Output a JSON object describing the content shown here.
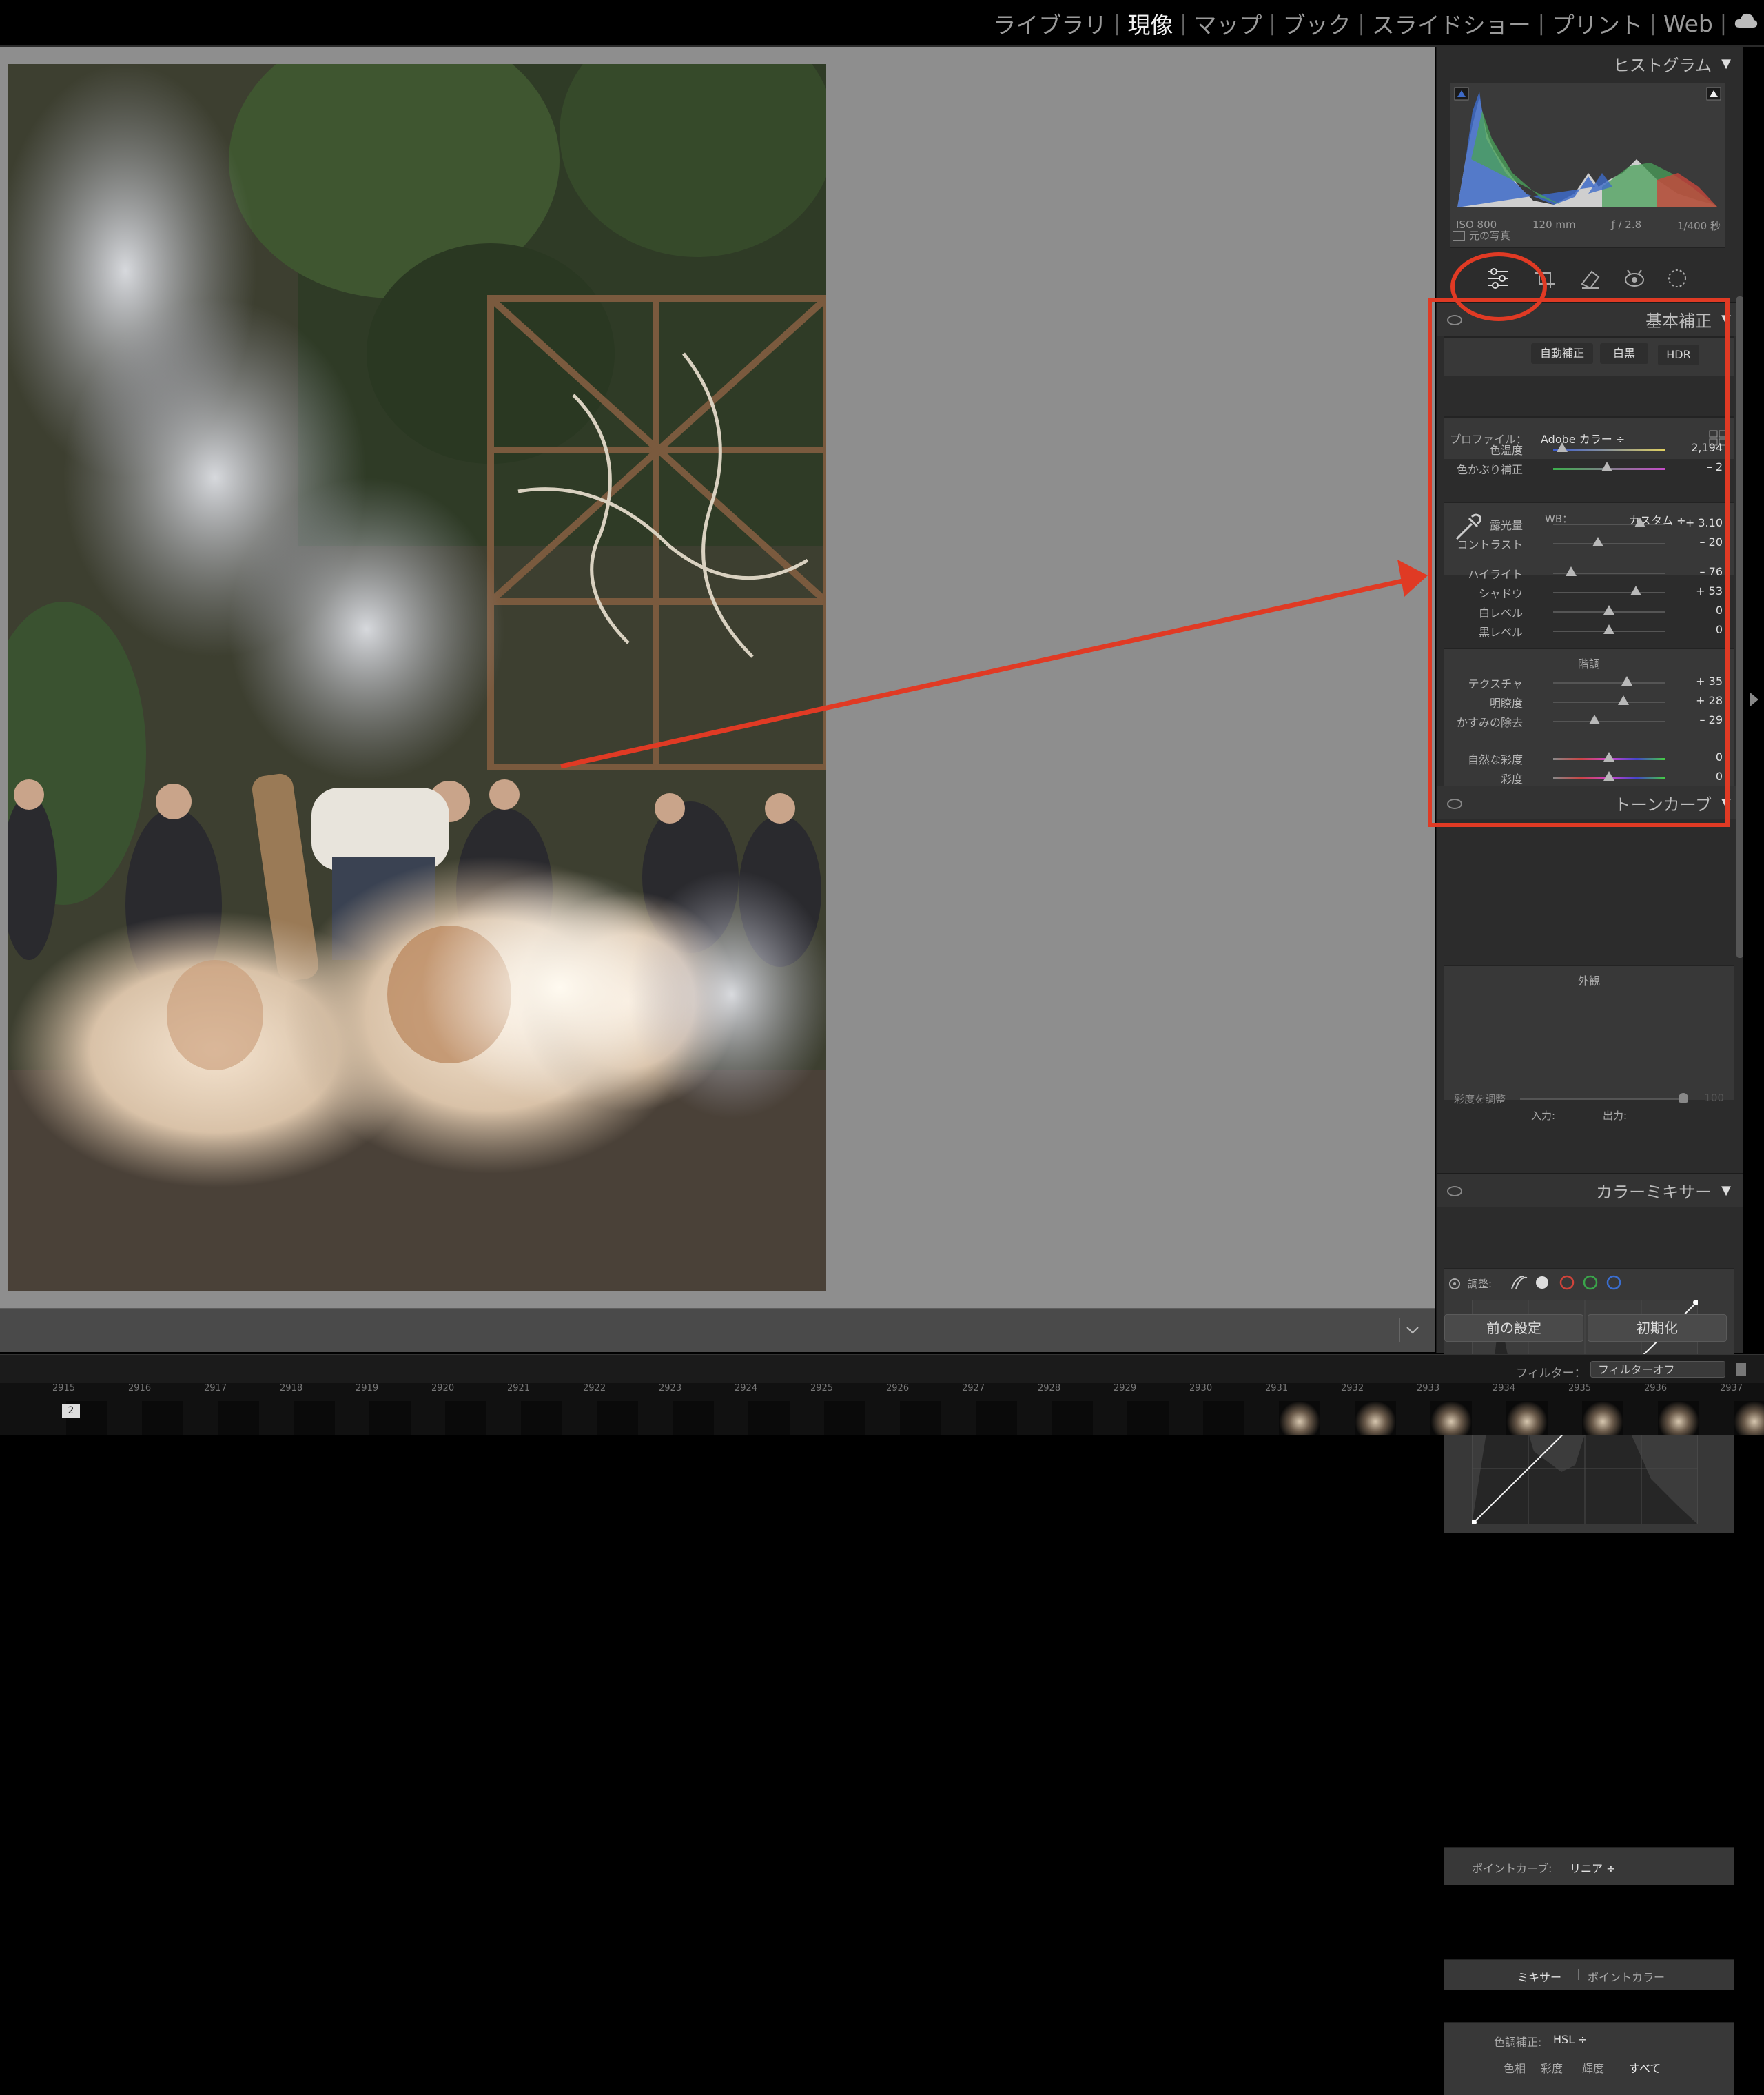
{
  "modules": [
    "ライブラリ",
    "現像",
    "マップ",
    "ブック",
    "スライドショー",
    "プリント",
    "Web"
  ],
  "active_module": "現像",
  "histogram": {
    "title": "ヒストグラム",
    "iso": "ISO 800",
    "focal": "120 mm",
    "aperture": "ƒ / 2.8",
    "shutter": "1/400 秒",
    "original_label": "元の写真"
  },
  "tools": [
    "sliders-icon",
    "crop-icon",
    "eraser-icon",
    "redeye-icon",
    "mask-icon"
  ],
  "basic": {
    "title": "基本補正",
    "auto": "自動補正",
    "bw": "白黒",
    "hdr": "HDR",
    "profile_label": "プロファイル：",
    "profile_value": "Adobe カラー ÷",
    "wb_label": "WB：",
    "wb_value": "カスタム ÷",
    "tone_title": "階調",
    "presence_title": "外観",
    "sliders": [
      {
        "label": "色温度",
        "value": "2,194",
        "pos": 0.08
      },
      {
        "label": "色かぶり補正",
        "value": "– 2",
        "pos": 0.48
      },
      {
        "label": "露光量",
        "value": "+ 3.10",
        "pos": 0.78
      },
      {
        "label": "コントラスト",
        "value": "– 20",
        "pos": 0.4
      },
      {
        "label": "ハイライト",
        "value": "– 76",
        "pos": 0.16
      },
      {
        "label": "シャドウ",
        "value": "+ 53",
        "pos": 0.74
      },
      {
        "label": "白レベル",
        "value": "0",
        "pos": 0.5
      },
      {
        "label": "黒レベル",
        "value": "0",
        "pos": 0.5
      },
      {
        "label": "テクスチャ",
        "value": "+ 35",
        "pos": 0.66
      },
      {
        "label": "明瞭度",
        "value": "+ 28",
        "pos": 0.63
      },
      {
        "label": "かすみの除去",
        "value": "– 29",
        "pos": 0.37
      },
      {
        "label": "自然な彩度",
        "value": "0",
        "pos": 0.5
      },
      {
        "label": "彩度",
        "value": "0",
        "pos": 0.5
      }
    ]
  },
  "tonecurve": {
    "title": "トーンカーブ",
    "adjust_label": "調整:",
    "sat_label": "彩度を調整",
    "sat_value": "100",
    "input_label": "入力:",
    "output_label": "出力:",
    "pointcurve_label": "ポイントカーブ:",
    "pointcurve_value": "リニア ÷"
  },
  "colormixer": {
    "title": "カラーミキサー",
    "tab_mixer": "ミキサー",
    "tab_point": "ポイントカラー",
    "adjust_label": "色調補正:",
    "adjust_value": "HSL ÷",
    "hue": "色相",
    "sat": "彩度",
    "lum": "輝度",
    "all": "すべて"
  },
  "buttons": {
    "prev": "前の設定",
    "reset": "初期化"
  },
  "filter": {
    "label": "フィルター：",
    "value": "フィルターオフ"
  },
  "filmstrip": {
    "numbers": [
      "2915",
      "2916",
      "2917",
      "2918",
      "2919",
      "2920",
      "2921",
      "2922",
      "2923",
      "2924",
      "2925",
      "2926",
      "2927",
      "2928",
      "2929",
      "2930",
      "2931",
      "2932",
      "2933",
      "2934",
      "2935",
      "2936",
      "2937"
    ],
    "badge": "2"
  },
  "colors": {
    "annotation": "#e03a24",
    "panel_bg": "#2c2c2c",
    "workspace_bg": "#8e8e8e"
  }
}
